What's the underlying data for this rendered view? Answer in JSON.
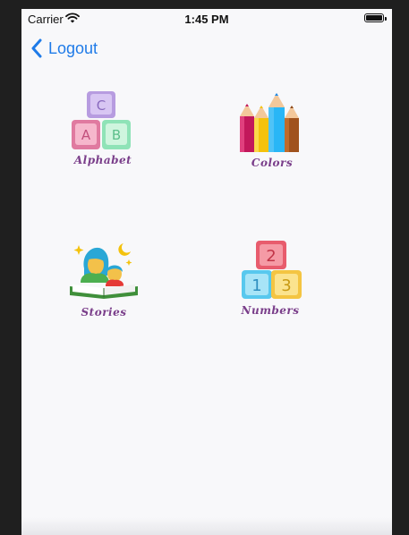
{
  "status_bar": {
    "carrier": "Carrier",
    "time": "1:45 PM"
  },
  "nav": {
    "back_label": "Logout"
  },
  "tiles": [
    {
      "label": "Alphabet",
      "icon": "alphabet-blocks-icon",
      "letters": [
        "C",
        "A",
        "B"
      ]
    },
    {
      "label": "Colors",
      "icon": "colored-pencils-icon"
    },
    {
      "label": "Stories",
      "icon": "mother-child-reading-icon"
    },
    {
      "label": "Numbers",
      "icon": "number-blocks-icon",
      "digits": [
        "2",
        "1",
        "3"
      ]
    }
  ],
  "colors": {
    "link": "#1f7be8",
    "label": "#7a3e8a"
  }
}
